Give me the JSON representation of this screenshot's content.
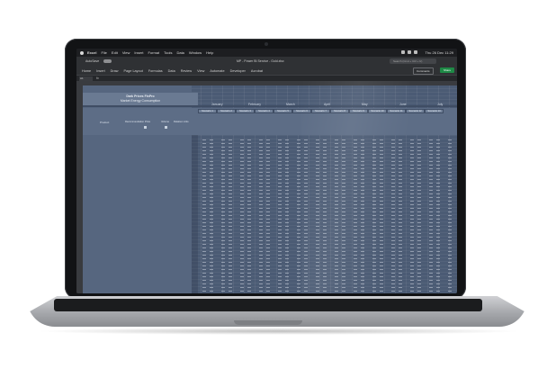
{
  "menubar": {
    "app": "Excel",
    "items": [
      "File",
      "Edit",
      "View",
      "Insert",
      "Format",
      "Tools",
      "Data",
      "Window",
      "Help"
    ],
    "clock": "Thu 26 Dec 11:29"
  },
  "titlebar": {
    "autosave_label": "AutoSave",
    "document_title": "MP - Power BI Service - Gold.xlsx"
  },
  "ribbon": {
    "tabs": [
      "Home",
      "Insert",
      "Draw",
      "Page Layout",
      "Formulas",
      "Data",
      "Review",
      "View",
      "Automate",
      "Developer",
      "Acrobat"
    ],
    "search_placeholder": "Search (Cmd + Ctrl + U)",
    "comments_label": "Comments",
    "share_label": "Share"
  },
  "formula_bar": {
    "cell_ref": "A1",
    "fx": "fx"
  },
  "sheet": {
    "title_line1": "Dark Prices FinPro",
    "title_line2": "Market Energy Consumption",
    "months": [
      "January",
      "February",
      "March",
      "April",
      "May",
      "June",
      "July"
    ],
    "scenario_headers": [
      "Scenario 1",
      "Scenario 2",
      "Scenario 3",
      "Scenario 4",
      "Scenario 5",
      "Scenario 6",
      "Scenario 7",
      "Scenario 8",
      "Scenario 9",
      "Scenario 10",
      "Scenario 11",
      "Scenario 12",
      "Scenario 13"
    ],
    "column_labels": [
      "Product",
      "Recommendation",
      "Price",
      "Volume",
      "Relative Units"
    ]
  },
  "colors": {
    "bezel": "#121315",
    "sheet_fill": "#4b5b74",
    "header_fill": "#6f7f97",
    "share_green": "#1e8a46"
  }
}
